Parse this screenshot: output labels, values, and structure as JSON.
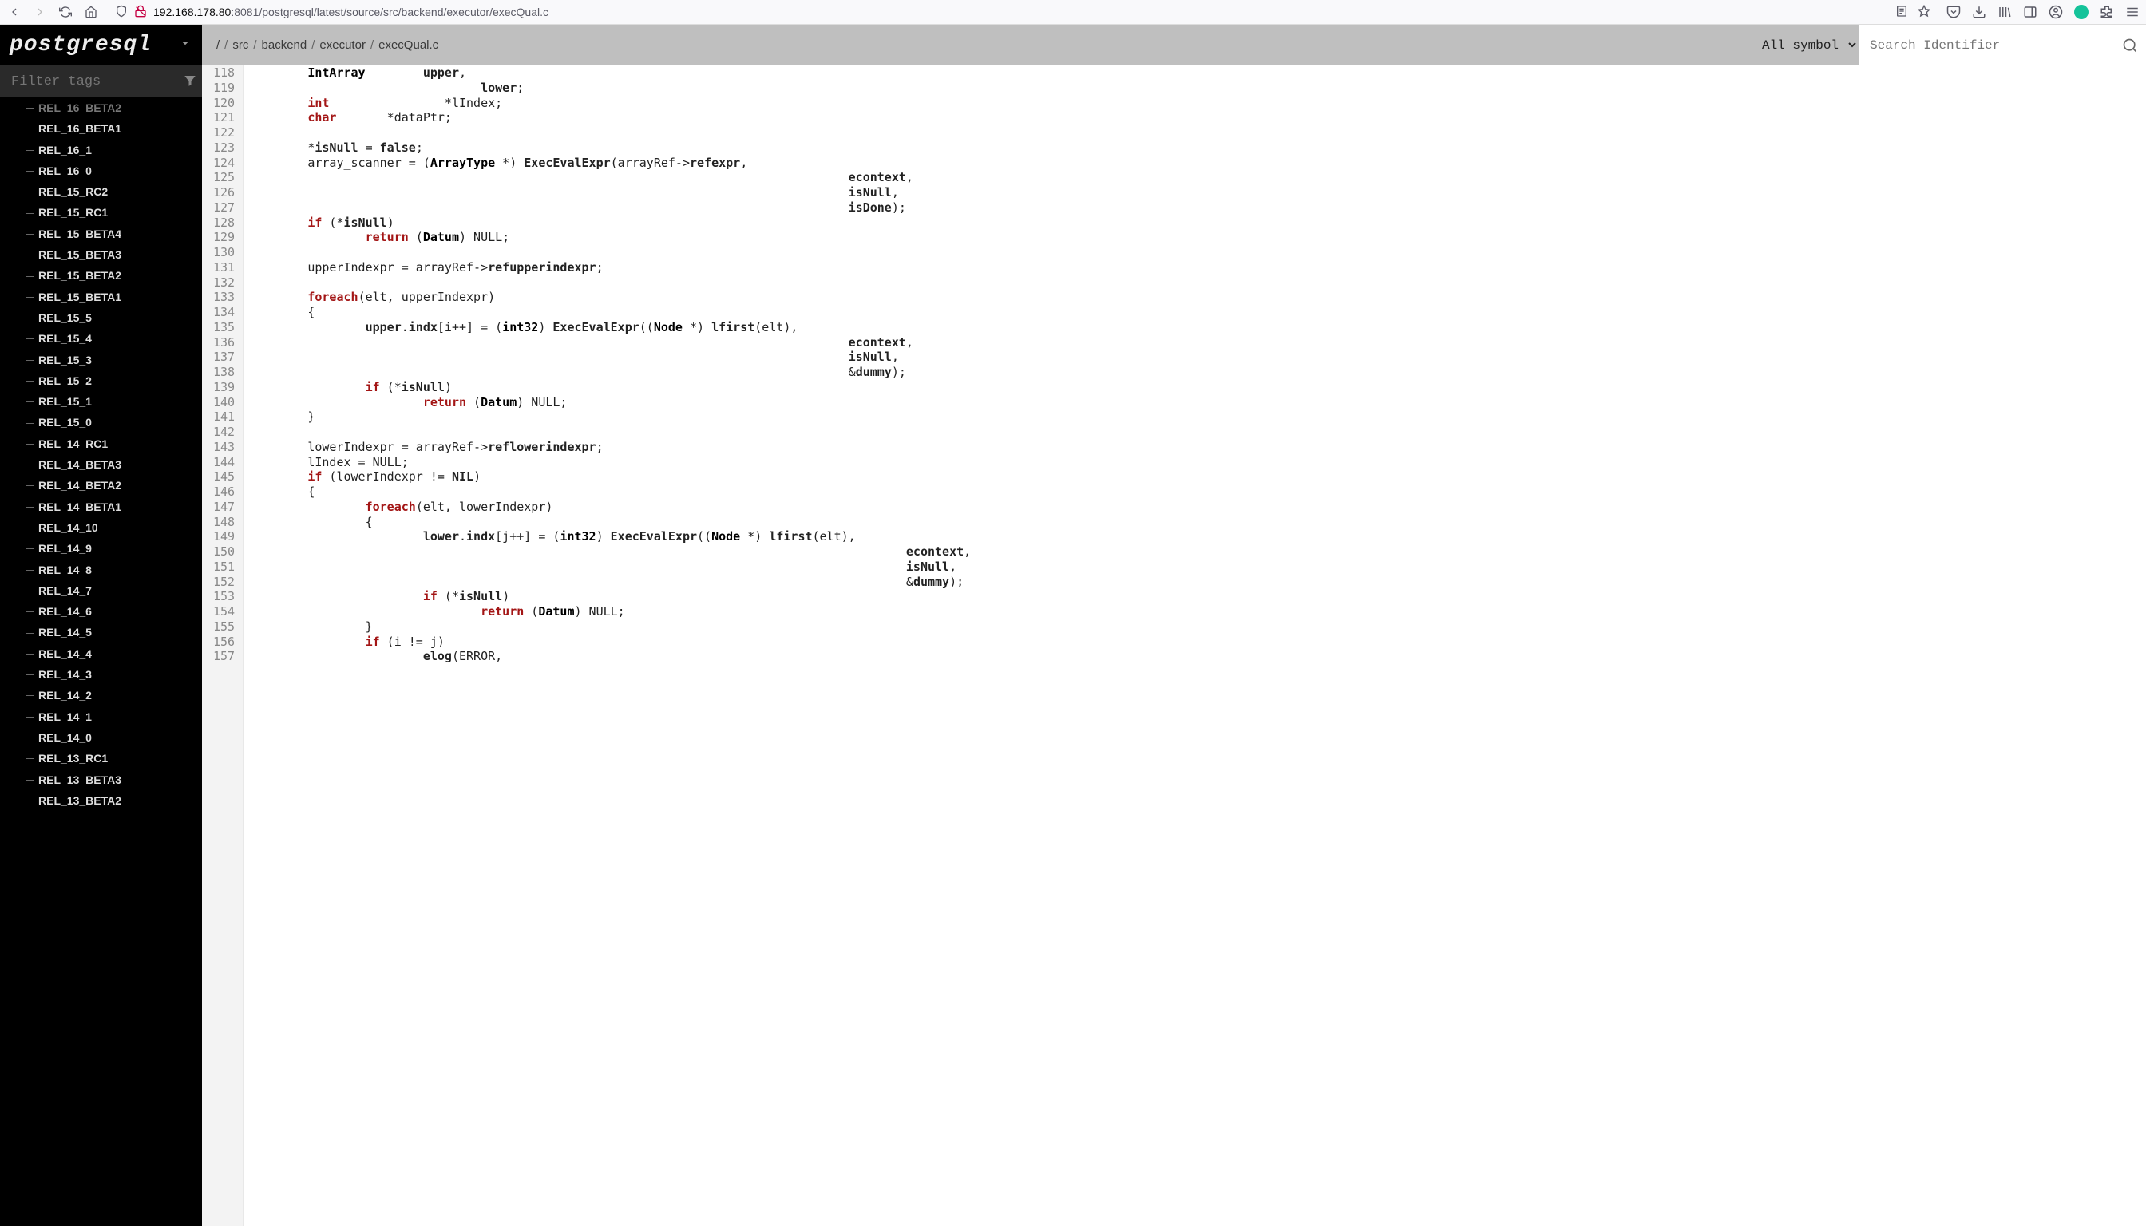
{
  "url": {
    "host": "192.168.178.80",
    "port": ":8081",
    "path": "/postgresql/latest/source/src/backend/executor/execQual.c"
  },
  "project": "postgresql",
  "breadcrumb": [
    "/",
    "src",
    "backend",
    "executor",
    "execQual.c"
  ],
  "symbol_select": "All symbol",
  "search_placeholder": "Search Identifier",
  "filter_placeholder": "Filter tags",
  "tags": [
    "REL_16_BETA2",
    "REL_16_BETA1",
    "REL_16_1",
    "REL_16_0",
    "REL_15_RC2",
    "REL_15_RC1",
    "REL_15_BETA4",
    "REL_15_BETA3",
    "REL_15_BETA2",
    "REL_15_BETA1",
    "REL_15_5",
    "REL_15_4",
    "REL_15_3",
    "REL_15_2",
    "REL_15_1",
    "REL_15_0",
    "REL_14_RC1",
    "REL_14_BETA3",
    "REL_14_BETA2",
    "REL_14_BETA1",
    "REL_14_10",
    "REL_14_9",
    "REL_14_8",
    "REL_14_7",
    "REL_14_6",
    "REL_14_5",
    "REL_14_4",
    "REL_14_3",
    "REL_14_2",
    "REL_14_1",
    "REL_14_0",
    "REL_13_RC1",
    "REL_13_BETA3",
    "REL_13_BETA2"
  ],
  "first_tag_cut": true,
  "line_start": 118,
  "code_lines": [
    {
      "n": 118,
      "html": "        <span class='ty'>IntArray</span>        <span class='id-b'>upper</span>,"
    },
    {
      "n": 119,
      "html": "                                <span class='id-b'>lower</span>;"
    },
    {
      "n": 120,
      "html": "        <span class='kw'>int</span>                *lIndex;"
    },
    {
      "n": 121,
      "html": "        <span class='kw'>char</span>       *dataPtr;"
    },
    {
      "n": 122,
      "html": ""
    },
    {
      "n": 123,
      "html": "        *<span class='id-b'>isNull</span> = <span class='lit'>false</span>;"
    },
    {
      "n": 124,
      "html": "        array_scanner = (<span class='ty'>ArrayType</span> *) <span class='id-b'>ExecEvalExpr</span>(arrayRef-&gt;<span class='id-b'>refexpr</span>,"
    },
    {
      "n": 125,
      "html": "                                                                                   <span class='id-b'>econtext</span>,"
    },
    {
      "n": 126,
      "html": "                                                                                   <span class='id-b'>isNull</span>,"
    },
    {
      "n": 127,
      "html": "                                                                                   <span class='id-b'>isDone</span>);"
    },
    {
      "n": 128,
      "html": "        <span class='kw'>if</span> (*<span class='id-b'>isNull</span>)"
    },
    {
      "n": 129,
      "html": "                <span class='kw'>return</span> (<span class='ty'>Datum</span>) NULL;"
    },
    {
      "n": 130,
      "html": ""
    },
    {
      "n": 131,
      "html": "        upperIndexpr = arrayRef-&gt;<span class='id-b'>refupperindexpr</span>;"
    },
    {
      "n": 132,
      "html": ""
    },
    {
      "n": 133,
      "html": "        <span class='kw'>foreach</span>(elt, upperIndexpr)"
    },
    {
      "n": 134,
      "html": "        {"
    },
    {
      "n": 135,
      "html": "                <span class='id-b'>upper</span>.<span class='id-b'>indx</span>[i++] = (<span class='ty'>int32</span>) <span class='id-b'>ExecEvalExpr</span>((<span class='ty'>Node</span> *) <span class='id-b'>lfirst</span>(elt),"
    },
    {
      "n": 136,
      "html": "                                                                                   <span class='id-b'>econtext</span>,"
    },
    {
      "n": 137,
      "html": "                                                                                   <span class='id-b'>isNull</span>,"
    },
    {
      "n": 138,
      "html": "                                                                                   &amp;<span class='id-b'>dummy</span>);"
    },
    {
      "n": 139,
      "html": "                <span class='kw'>if</span> (*<span class='id-b'>isNull</span>)"
    },
    {
      "n": 140,
      "html": "                        <span class='kw'>return</span> (<span class='ty'>Datum</span>) NULL;"
    },
    {
      "n": 141,
      "html": "        }"
    },
    {
      "n": 142,
      "html": ""
    },
    {
      "n": 143,
      "html": "        lowerIndexpr = arrayRef-&gt;<span class='id-b'>reflowerindexpr</span>;"
    },
    {
      "n": 144,
      "html": "        lIndex = NULL;"
    },
    {
      "n": 145,
      "html": "        <span class='kw'>if</span> (lowerIndexpr != <span class='lit'>NIL</span>)"
    },
    {
      "n": 146,
      "html": "        {"
    },
    {
      "n": 147,
      "html": "                <span class='kw'>foreach</span>(elt, lowerIndexpr)"
    },
    {
      "n": 148,
      "html": "                {"
    },
    {
      "n": 149,
      "html": "                        <span class='id-b'>lower</span>.<span class='id-b'>indx</span>[j++] = (<span class='ty'>int32</span>) <span class='id-b'>ExecEvalExpr</span>((<span class='ty'>Node</span> *) <span class='id-b'>lfirst</span>(elt),"
    },
    {
      "n": 150,
      "html": "                                                                                           <span class='id-b'>econtext</span>,"
    },
    {
      "n": 151,
      "html": "                                                                                           <span class='id-b'>isNull</span>,"
    },
    {
      "n": 152,
      "html": "                                                                                           &amp;<span class='id-b'>dummy</span>);"
    },
    {
      "n": 153,
      "html": "                        <span class='kw'>if</span> (*<span class='id-b'>isNull</span>)"
    },
    {
      "n": 154,
      "html": "                                <span class='kw'>return</span> (<span class='ty'>Datum</span>) NULL;"
    },
    {
      "n": 155,
      "html": "                }"
    },
    {
      "n": 156,
      "html": "                <span class='kw'>if</span> (i != j)"
    },
    {
      "n": 157,
      "html": "                        <span class='id-b'>elog</span>(ERROR,"
    }
  ]
}
